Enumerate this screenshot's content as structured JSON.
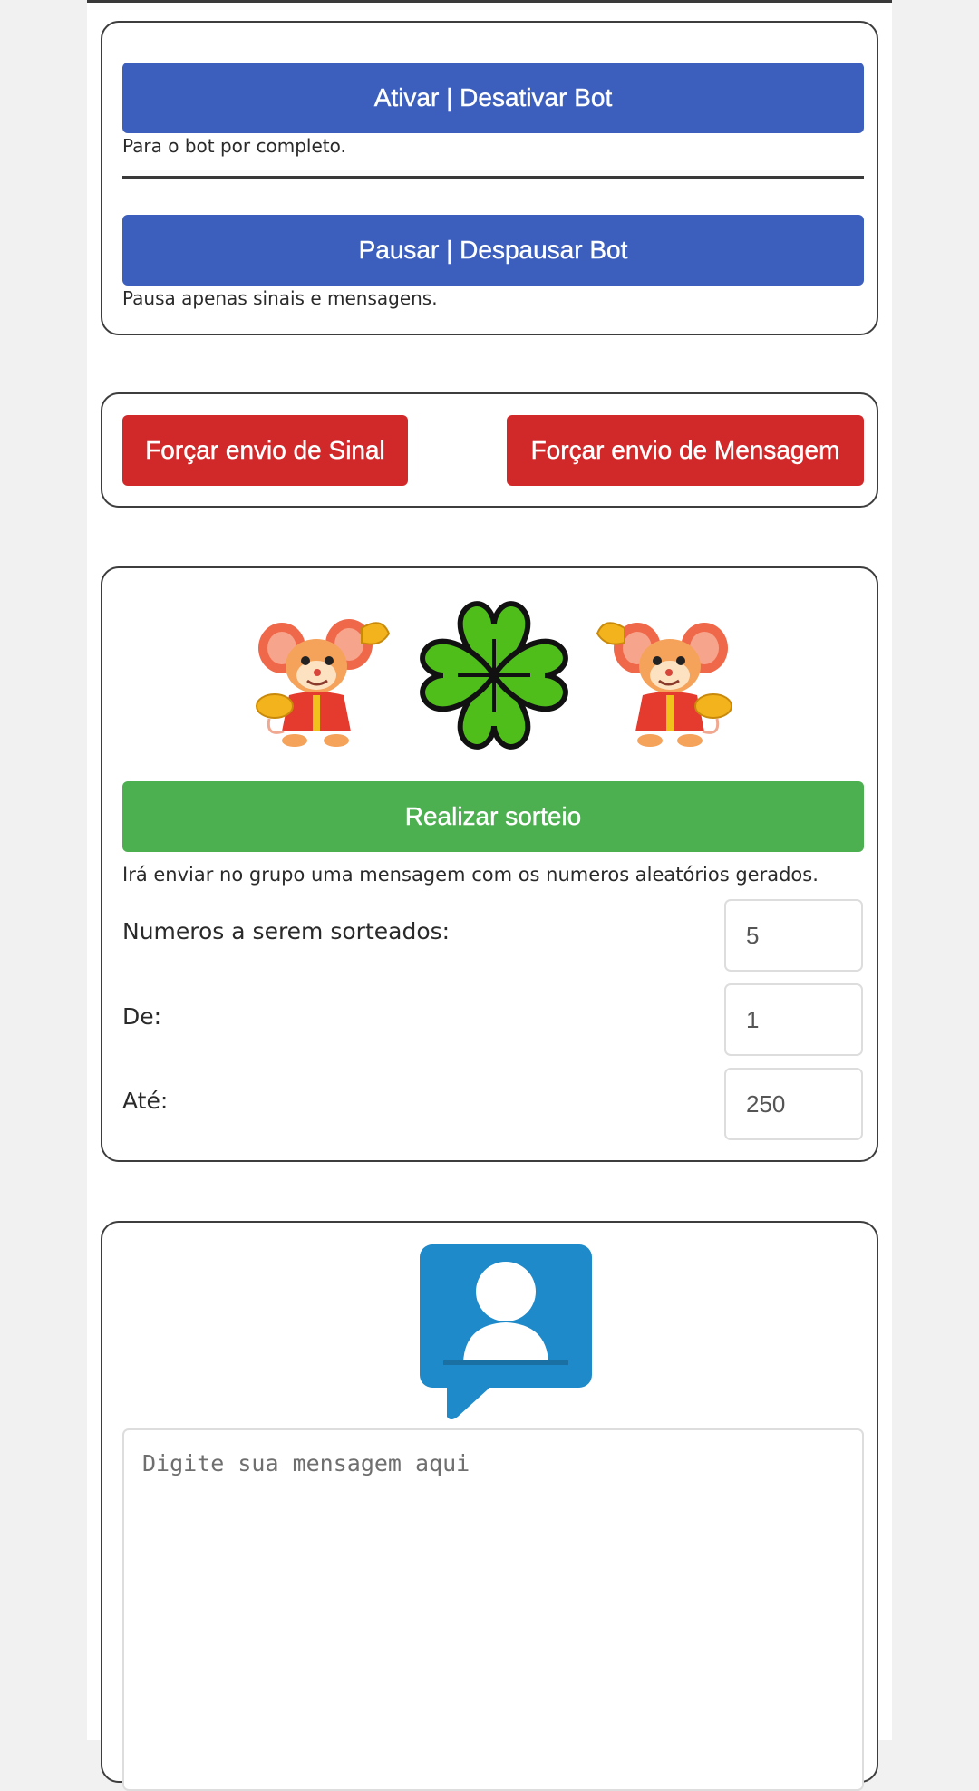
{
  "control": {
    "toggle_button": "Ativar | Desativar Bot",
    "toggle_note": "Para o bot por completo.",
    "pause_button": "Pausar | Despausar Bot",
    "pause_note": "Pausa apenas sinais e mensagens."
  },
  "force": {
    "signal_button": "Forçar envio de Sinal",
    "message_button": "Forçar envio de Mensagem"
  },
  "draw": {
    "images": [
      "mouse-mascot-icon",
      "four-leaf-clover-icon",
      "mouse-mascot-icon"
    ],
    "button": "Realizar sorteio",
    "note": "Irá enviar no grupo uma mensagem com os numeros aleatórios gerados.",
    "fields": [
      {
        "label": "Numeros a serem sorteados:",
        "value": "5"
      },
      {
        "label": "De:",
        "value": "1"
      },
      {
        "label": "Até:",
        "value": "250"
      }
    ]
  },
  "message": {
    "icon": "user-chat-icon",
    "placeholder": "Digite sua mensagem aqui"
  },
  "colors": {
    "blue": "#3c5fbd",
    "red": "#d1292a",
    "green": "#4caf50",
    "icon_blue": "#1f8ac9"
  }
}
